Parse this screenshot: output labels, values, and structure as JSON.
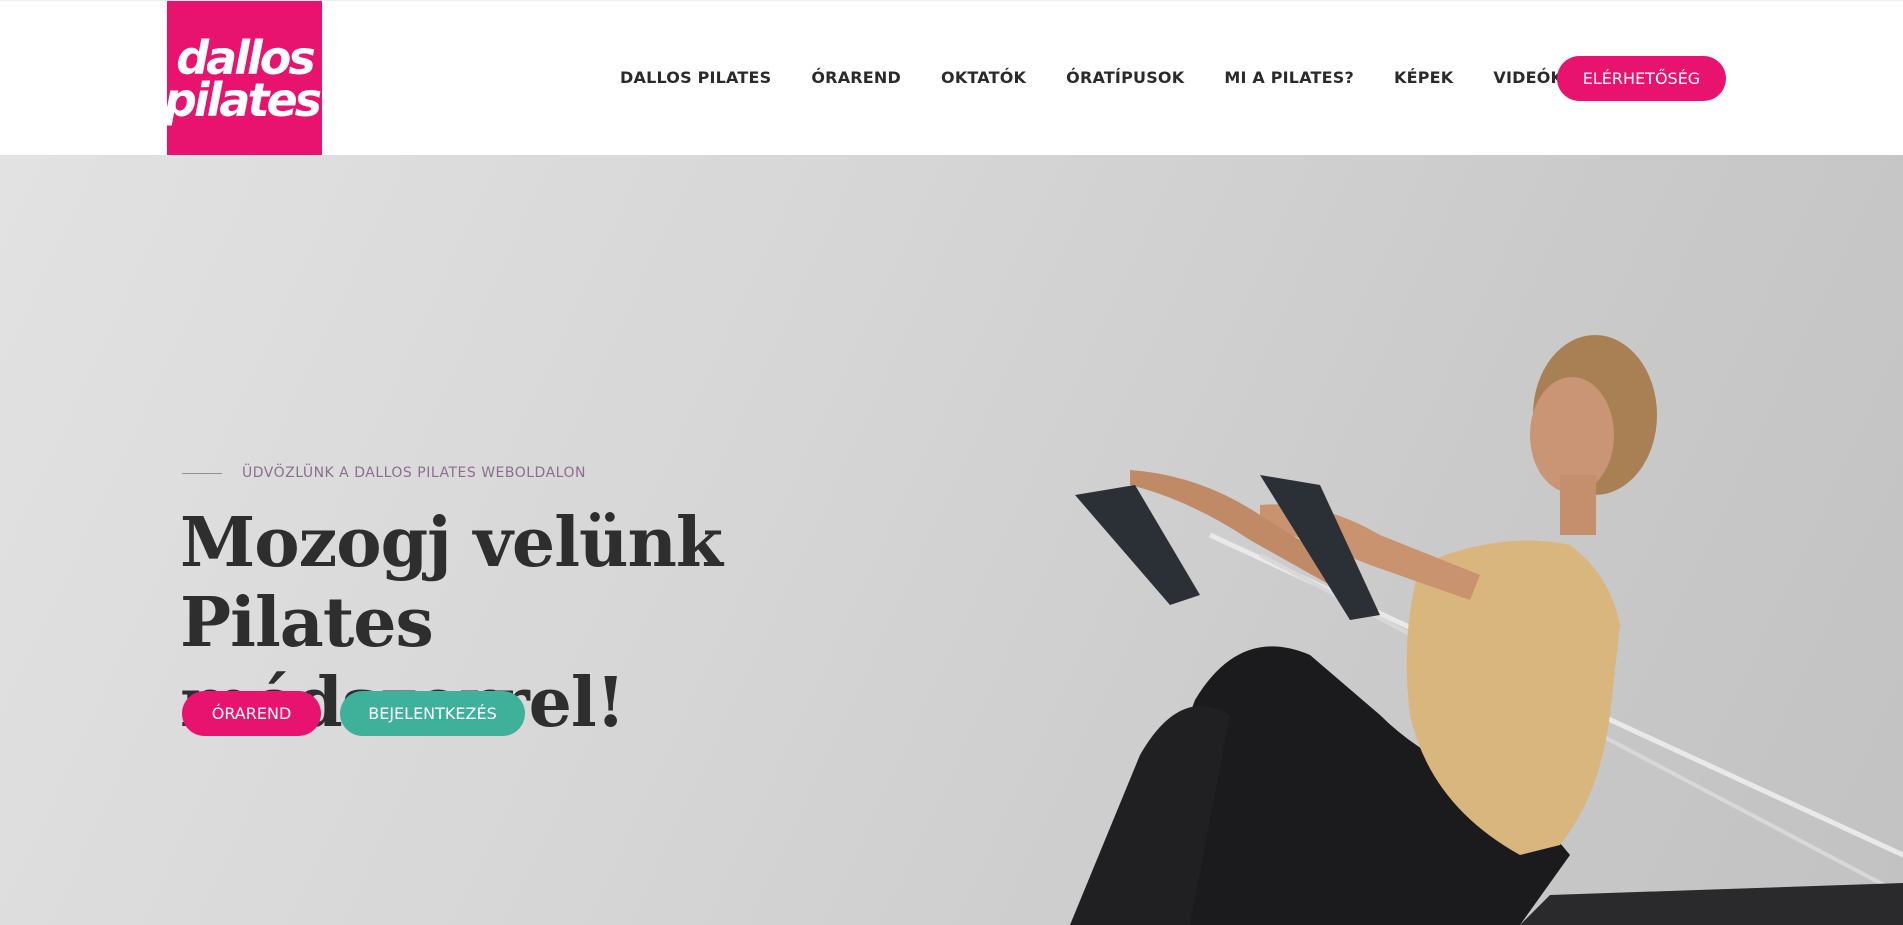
{
  "logo": {
    "line1": "dallos",
    "line2": "pilates"
  },
  "nav": {
    "items": [
      "DALLOS PILATES",
      "ÓRAREND",
      "OKTATÓK",
      "ÓRATÍPUSOK",
      "MI A PILATES?",
      "KÉPEK",
      "VIDEÓK"
    ],
    "contact_label": "ELÉRHETŐSÉG"
  },
  "hero": {
    "eyebrow": "ÜDVÖZLÜNK A DALLOS PILATES WEBOLDALON",
    "headline_line1": "Mozogj velünk",
    "headline_line2": "Pilates módszerrel!",
    "primary_button": "ÓRAREND",
    "secondary_button": "BEJELENTKEZÉS"
  },
  "colors": {
    "brand_pink": "#e8136f",
    "teal": "#3fb09a",
    "text_dark": "#2e2e2e",
    "eyebrow": "#8a6f8e"
  },
  "icons": {
    "hero_image": "woman-pilates-reformer-photo"
  }
}
